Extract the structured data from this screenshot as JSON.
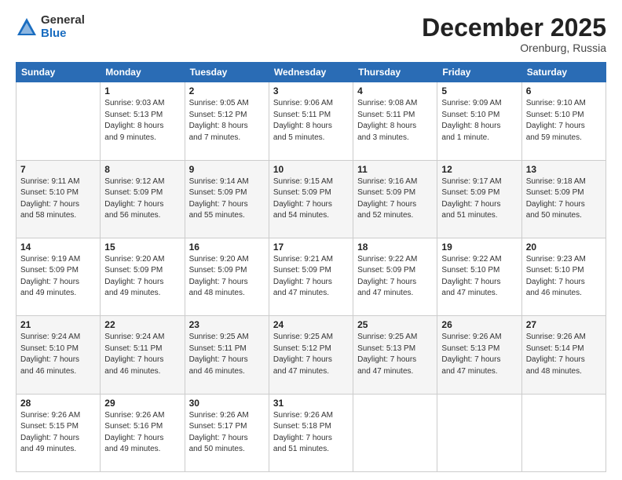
{
  "logo": {
    "general": "General",
    "blue": "Blue"
  },
  "header": {
    "month": "December 2025",
    "location": "Orenburg, Russia"
  },
  "days_of_week": [
    "Sunday",
    "Monday",
    "Tuesday",
    "Wednesday",
    "Thursday",
    "Friday",
    "Saturday"
  ],
  "weeks": [
    [
      {
        "day": "",
        "info": ""
      },
      {
        "day": "1",
        "info": "Sunrise: 9:03 AM\nSunset: 5:13 PM\nDaylight: 8 hours\nand 9 minutes."
      },
      {
        "day": "2",
        "info": "Sunrise: 9:05 AM\nSunset: 5:12 PM\nDaylight: 8 hours\nand 7 minutes."
      },
      {
        "day": "3",
        "info": "Sunrise: 9:06 AM\nSunset: 5:11 PM\nDaylight: 8 hours\nand 5 minutes."
      },
      {
        "day": "4",
        "info": "Sunrise: 9:08 AM\nSunset: 5:11 PM\nDaylight: 8 hours\nand 3 minutes."
      },
      {
        "day": "5",
        "info": "Sunrise: 9:09 AM\nSunset: 5:10 PM\nDaylight: 8 hours\nand 1 minute."
      },
      {
        "day": "6",
        "info": "Sunrise: 9:10 AM\nSunset: 5:10 PM\nDaylight: 7 hours\nand 59 minutes."
      }
    ],
    [
      {
        "day": "7",
        "info": "Sunrise: 9:11 AM\nSunset: 5:10 PM\nDaylight: 7 hours\nand 58 minutes."
      },
      {
        "day": "8",
        "info": "Sunrise: 9:12 AM\nSunset: 5:09 PM\nDaylight: 7 hours\nand 56 minutes."
      },
      {
        "day": "9",
        "info": "Sunrise: 9:14 AM\nSunset: 5:09 PM\nDaylight: 7 hours\nand 55 minutes."
      },
      {
        "day": "10",
        "info": "Sunrise: 9:15 AM\nSunset: 5:09 PM\nDaylight: 7 hours\nand 54 minutes."
      },
      {
        "day": "11",
        "info": "Sunrise: 9:16 AM\nSunset: 5:09 PM\nDaylight: 7 hours\nand 52 minutes."
      },
      {
        "day": "12",
        "info": "Sunrise: 9:17 AM\nSunset: 5:09 PM\nDaylight: 7 hours\nand 51 minutes."
      },
      {
        "day": "13",
        "info": "Sunrise: 9:18 AM\nSunset: 5:09 PM\nDaylight: 7 hours\nand 50 minutes."
      }
    ],
    [
      {
        "day": "14",
        "info": "Sunrise: 9:19 AM\nSunset: 5:09 PM\nDaylight: 7 hours\nand 49 minutes."
      },
      {
        "day": "15",
        "info": "Sunrise: 9:20 AM\nSunset: 5:09 PM\nDaylight: 7 hours\nand 49 minutes."
      },
      {
        "day": "16",
        "info": "Sunrise: 9:20 AM\nSunset: 5:09 PM\nDaylight: 7 hours\nand 48 minutes."
      },
      {
        "day": "17",
        "info": "Sunrise: 9:21 AM\nSunset: 5:09 PM\nDaylight: 7 hours\nand 47 minutes."
      },
      {
        "day": "18",
        "info": "Sunrise: 9:22 AM\nSunset: 5:09 PM\nDaylight: 7 hours\nand 47 minutes."
      },
      {
        "day": "19",
        "info": "Sunrise: 9:22 AM\nSunset: 5:10 PM\nDaylight: 7 hours\nand 47 minutes."
      },
      {
        "day": "20",
        "info": "Sunrise: 9:23 AM\nSunset: 5:10 PM\nDaylight: 7 hours\nand 46 minutes."
      }
    ],
    [
      {
        "day": "21",
        "info": "Sunrise: 9:24 AM\nSunset: 5:10 PM\nDaylight: 7 hours\nand 46 minutes."
      },
      {
        "day": "22",
        "info": "Sunrise: 9:24 AM\nSunset: 5:11 PM\nDaylight: 7 hours\nand 46 minutes."
      },
      {
        "day": "23",
        "info": "Sunrise: 9:25 AM\nSunset: 5:11 PM\nDaylight: 7 hours\nand 46 minutes."
      },
      {
        "day": "24",
        "info": "Sunrise: 9:25 AM\nSunset: 5:12 PM\nDaylight: 7 hours\nand 47 minutes."
      },
      {
        "day": "25",
        "info": "Sunrise: 9:25 AM\nSunset: 5:13 PM\nDaylight: 7 hours\nand 47 minutes."
      },
      {
        "day": "26",
        "info": "Sunrise: 9:26 AM\nSunset: 5:13 PM\nDaylight: 7 hours\nand 47 minutes."
      },
      {
        "day": "27",
        "info": "Sunrise: 9:26 AM\nSunset: 5:14 PM\nDaylight: 7 hours\nand 48 minutes."
      }
    ],
    [
      {
        "day": "28",
        "info": "Sunrise: 9:26 AM\nSunset: 5:15 PM\nDaylight: 7 hours\nand 49 minutes."
      },
      {
        "day": "29",
        "info": "Sunrise: 9:26 AM\nSunset: 5:16 PM\nDaylight: 7 hours\nand 49 minutes."
      },
      {
        "day": "30",
        "info": "Sunrise: 9:26 AM\nSunset: 5:17 PM\nDaylight: 7 hours\nand 50 minutes."
      },
      {
        "day": "31",
        "info": "Sunrise: 9:26 AM\nSunset: 5:18 PM\nDaylight: 7 hours\nand 51 minutes."
      },
      {
        "day": "",
        "info": ""
      },
      {
        "day": "",
        "info": ""
      },
      {
        "day": "",
        "info": ""
      }
    ]
  ]
}
